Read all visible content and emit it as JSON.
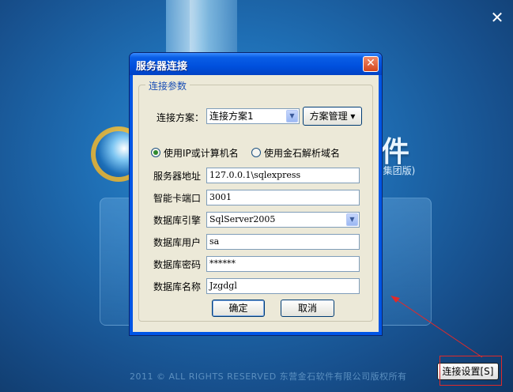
{
  "background": {
    "big_char": "件",
    "edition": "(集团版)",
    "copyright": "2011 ©  ALL RIGHTS RESERVED 东营金石软件有限公司版权所有",
    "close_glyph": "✕",
    "connect_button_label": "连接设置[S]"
  },
  "dialog": {
    "title": "服务器连接",
    "close_glyph": "✕",
    "group_title": "连接参数",
    "scheme_label": "连接方案：",
    "scheme_value": "连接方案1",
    "scheme_manage_label": "方案管理 ▾",
    "radio_ip_label": "使用IP或计算机名",
    "radio_domain_label": "使用金石解析域名",
    "fields": {
      "server_label": "服务器地址",
      "server_value": "127.0.0.1\\sqlexpress",
      "port_label": "智能卡端口",
      "port_value": "3001",
      "engine_label": "数据库引擎",
      "engine_value": "SqlServer2005",
      "user_label": "数据库用户",
      "user_value": "sa",
      "password_label": "数据库密码",
      "password_value": "******",
      "dbname_label": "数据库名称",
      "dbname_value": "Jzgdgl"
    },
    "ok_label": "确定",
    "cancel_label": "取消"
  },
  "colors": {
    "accent": "#0055e5",
    "annotation_red": "#e02a2a"
  }
}
